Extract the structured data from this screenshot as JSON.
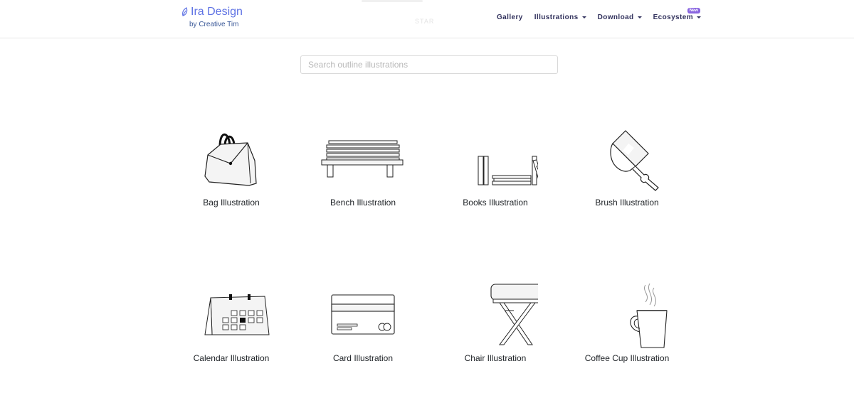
{
  "brand": {
    "title": "Ira Design",
    "subtitle": "by Creative Tim"
  },
  "header_ghost_text": "STAR",
  "nav": {
    "items": [
      {
        "label": "Gallery",
        "dropdown": false
      },
      {
        "label": "Illustrations",
        "dropdown": true
      },
      {
        "label": "Download",
        "dropdown": true
      },
      {
        "label": "Ecosystem",
        "dropdown": true,
        "badge": "New"
      }
    ]
  },
  "search": {
    "placeholder": "Search outline illustrations",
    "value": ""
  },
  "gallery": {
    "items": [
      {
        "label": "Bag Illustration",
        "icon": "bag-icon"
      },
      {
        "label": "Bench Illustration",
        "icon": "bench-icon"
      },
      {
        "label": "Books Illustration",
        "icon": "books-icon"
      },
      {
        "label": "Brush Illustration",
        "icon": "brush-icon"
      },
      {
        "label": "Calendar Illustration",
        "icon": "calendar-icon"
      },
      {
        "label": "Card Illustration",
        "icon": "card-icon"
      },
      {
        "label": "Chair Illustration",
        "icon": "chair-icon"
      },
      {
        "label": "Coffee Cup Illustration",
        "icon": "coffee-cup-icon"
      }
    ]
  },
  "colors": {
    "accent": "#5e72e4",
    "nav_text": "#32325d",
    "badge": "#8965e0",
    "outline": "#222222",
    "fill": "#f4f4f4"
  }
}
